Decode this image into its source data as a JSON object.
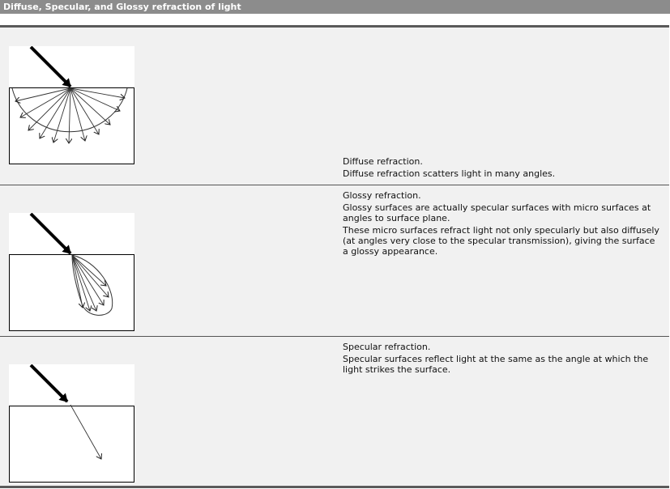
{
  "header": {
    "title": "Diffuse, Specular, and Glossy refraction of light"
  },
  "rows": [
    {
      "heading": "Diffuse refraction.",
      "lines": [
        "Diffuse refraction scatters light in many angles."
      ]
    },
    {
      "heading": "Glossy refraction.",
      "lines": [
        "Glossy surfaces are actually specular surfaces with micro surfaces at angles to surface plane.",
        "These micro surfaces refract light not only specularly but also diffusely (at angles very close to the specular transmission), giving the surface a glossy appearance."
      ]
    },
    {
      "heading": "Specular refraction.",
      "lines": [
        "Specular surfaces reflect light at the same as the angle at which the light strikes the surface."
      ]
    }
  ],
  "icons": [
    "diffuse-refraction-diagram",
    "glossy-refraction-diagram",
    "specular-refraction-diagram"
  ]
}
